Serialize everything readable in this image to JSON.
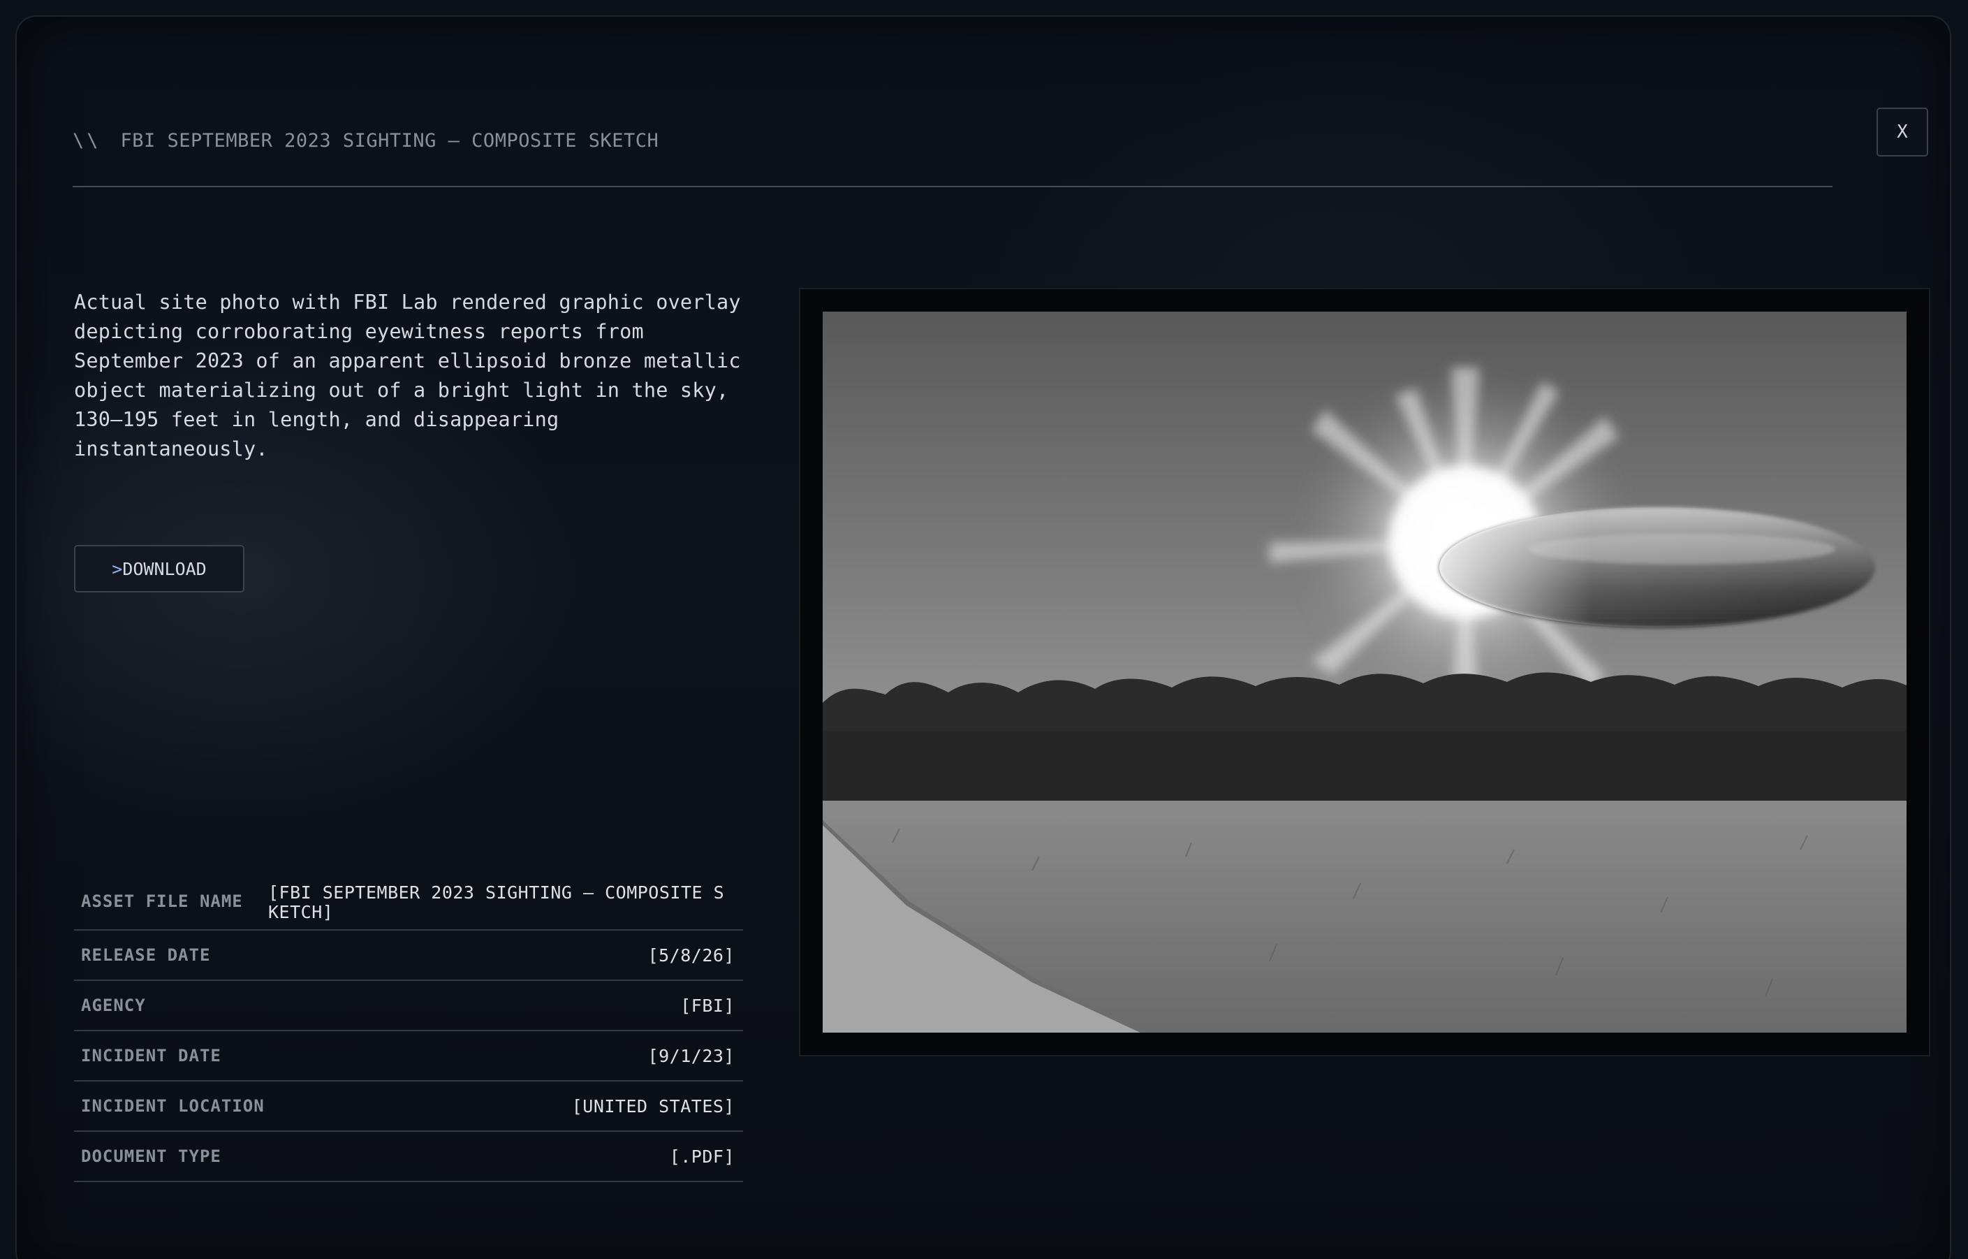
{
  "header": {
    "prefix": "\\\\",
    "title": "FBI SEPTEMBER 2023 SIGHTING – COMPOSITE SKETCH"
  },
  "close_label": "X",
  "description": "Actual site photo with FBI Lab rendered graphic overlay depicting corroborating eyewitness reports from September 2023 of an apparent ellipsoid bronze metallic object materializing out of a bright light in the sky, 130–195 feet in length, and disappearing instantaneously.",
  "download": {
    "prefix": ">",
    "label": "DOWNLOAD"
  },
  "metadata": [
    {
      "key": "ASSET FILE NAME",
      "value": "[FBI SEPTEMBER 2023 SIGHTING – COMPOSITE SKETCH]"
    },
    {
      "key": "RELEASE DATE",
      "value": "[5/8/26]"
    },
    {
      "key": "AGENCY",
      "value": "[FBI]"
    },
    {
      "key": "INCIDENT DATE",
      "value": "[9/1/23]"
    },
    {
      "key": "INCIDENT LOCATION",
      "value": "[UNITED STATES]"
    },
    {
      "key": "DOCUMENT TYPE",
      "value": "[.PDF]"
    }
  ],
  "image": {
    "subject": "grayscale field photo with treeline, bright starburst and ellipsoid object",
    "colors": {
      "sky_top": "#5a5a5a",
      "sky_bottom": "#8e8e8e",
      "trees": "#2a2a2a",
      "grass": "#7a7a7a"
    }
  },
  "colors": {
    "background": "#0c1017",
    "accent": "#8fb4ff",
    "text": "#d6d9de",
    "muted": "#8a9099"
  }
}
